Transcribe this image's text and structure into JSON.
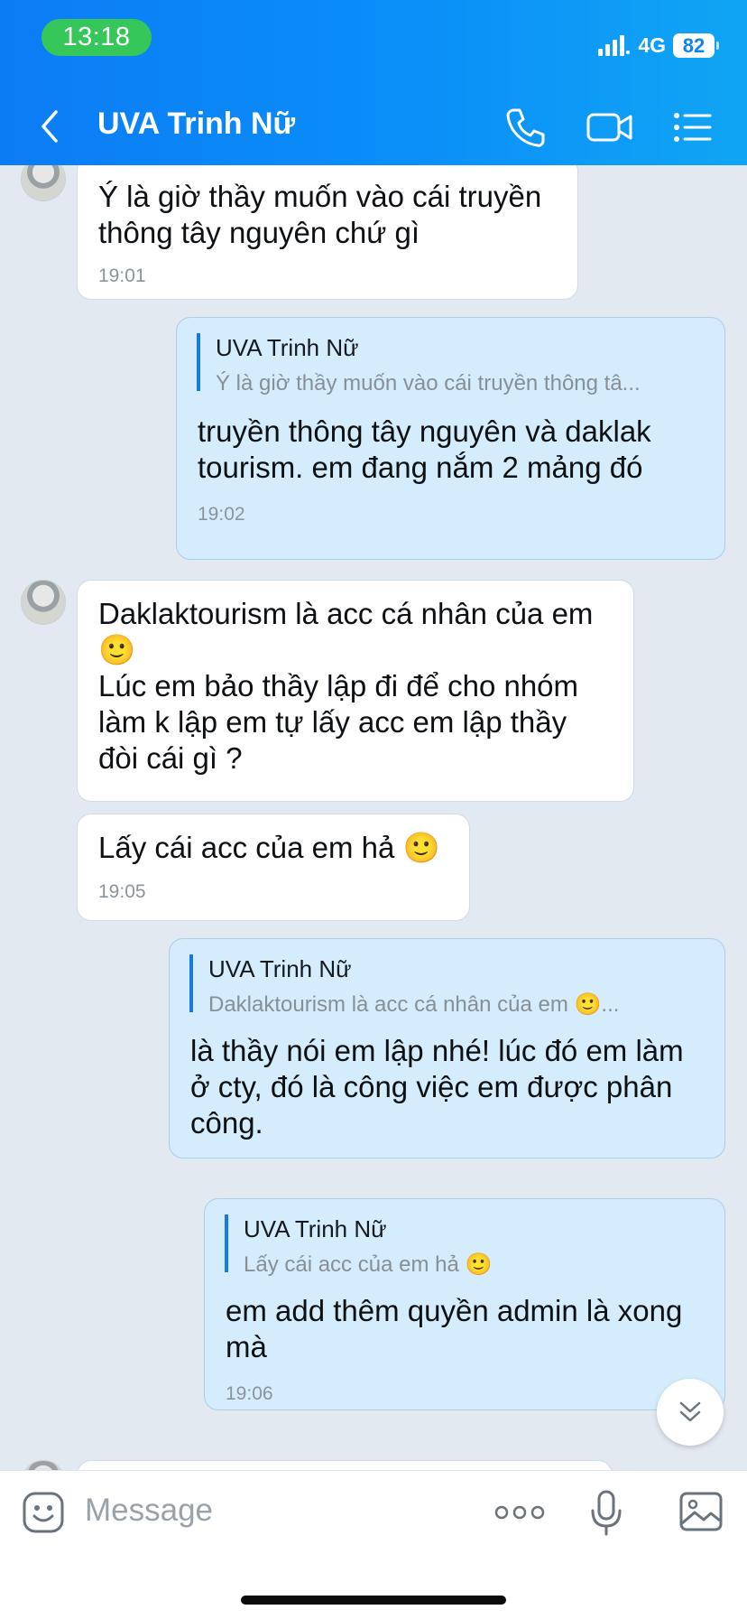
{
  "status_bar": {
    "time": "13:18",
    "network": "4G",
    "battery": "82"
  },
  "header": {
    "title": "UVA Trinh Nữ",
    "icons": [
      "back-icon",
      "phone-icon",
      "video-call-icon",
      "menu-list-icon"
    ]
  },
  "messages": [
    {
      "side": "in",
      "text": "Ý là giờ thầy muốn vào cái truyền\nthông tây nguyên chứ gì",
      "time": "19:01"
    },
    {
      "side": "out",
      "quote_name": "UVA Trinh Nữ",
      "quote_text": "Ý là giờ thầy muốn vào cái truyền thông tâ...",
      "text": "truyền thông tây nguyên và daklak\ntourism. em đang nắm 2 mảng đó",
      "time": "19:02"
    },
    {
      "side": "in",
      "text": "Daklaktourism là acc cá nhân của em\n🙂\nLúc em bảo thầy lập đi để cho nhóm\nlàm k lập em tự lấy acc em lập thầy\nđòi cái gì ?"
    },
    {
      "side": "in",
      "text": "Lấy cái acc của em hả 🙂",
      "time": "19:05"
    },
    {
      "side": "out",
      "quote_name": "UVA Trinh Nữ",
      "quote_text": "Daklaktourism là acc cá nhân của em 🙂...",
      "text": "là thầy nói em lập nhé! lúc đó em làm\nở cty, đó là công việc em được phân\ncông."
    },
    {
      "side": "out",
      "quote_name": "UVA Trinh Nữ",
      "quote_text": "Lấy cái acc của em hả 🙂",
      "text": "em add thêm quyền admin là xong\nmà",
      "time": "19:06"
    }
  ],
  "input": {
    "placeholder": "Message",
    "icons": [
      "sticker-icon",
      "more-icon",
      "microphone-icon",
      "image-icon"
    ]
  },
  "colors": {
    "header_blue": "#0a8ff8",
    "outgoing_bubble": "#d4ecfb",
    "incoming_bubble": "#ffffff",
    "chat_background": "#e2e9f1",
    "quote_bar": "#1679ea"
  }
}
